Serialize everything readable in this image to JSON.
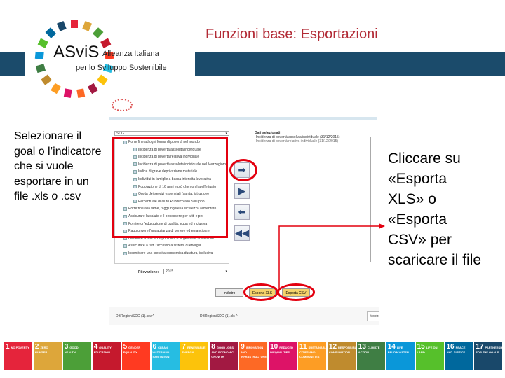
{
  "header": {
    "title": "Funzioni base: Esportazioni",
    "logo_text": "ASviS Alleanza Italiana per lo Sviluppo Sostenibile",
    "band_color": "#1b4b6b",
    "title_color": "#b22a35"
  },
  "left_text": "Selezionare il goal o l’indicatore che si vuole esportare in un file .xls o .csv",
  "right_text": "Cliccare su «Esporta XLS» o «Esporta CSV» per scaricare il file",
  "screenshot": {
    "sdg_select": "SDG",
    "tree": [
      "Porre fine ad ogni forma di povertà nel mondo",
      "Incidenza di povertà assoluta individuale",
      "Incidenza di povertà relativa individuale",
      "Incidenza di povertà assoluta individuale nel Mezzogiorno",
      "Indice di grave deprivazione materiale",
      "Individui in famiglie a bassa intensità lavorativa",
      "Popolazione di 16 anni e più che non ha effettuato",
      "Quota dei servizi essenziali (sanità, istruzione",
      "Percentuale di aiuto Pubblico allo Sviluppo",
      "Porre fine alla fame, raggiungere la sicurezza alimentare",
      "Assicurare la salute e il benessere per tutti e per",
      "Fornire un'educazione di qualità, equa ed inclusiva",
      "Raggiungere l'uguaglianza di genere ed emancipare",
      "Garantire a tutti la disponibilità e la gestione sostenibile",
      "Assicurare a tutti l'accesso a sistemi di energia",
      "Incentivare una crescita economica duratura, inclusiva"
    ],
    "selected_title": "Dati selezionati",
    "selected": [
      "Incidenza di povertà assoluta individuale (31/12/2015)",
      "Incidenza di povertà relativa individuale (31/12/2015)"
    ],
    "rilevazione_label": "Rilevazione:",
    "rilevazione_value": "2015",
    "buttons": {
      "back": "Indietro",
      "xls": "Esporta XLS",
      "csv": "Esporta CSV"
    },
    "downloads": [
      "DBRegioniSDG (1).csv",
      "DBRegioniSDG (1).xls"
    ],
    "show_all": "Mostra tutto"
  },
  "sdgs": [
    {
      "n": "1",
      "label": "NO POVERTY",
      "color": "#e5243b"
    },
    {
      "n": "2",
      "label": "ZERO HUNGER",
      "color": "#dda63a"
    },
    {
      "n": "3",
      "label": "GOOD HEALTH",
      "color": "#4c9f38"
    },
    {
      "n": "4",
      "label": "QUALITY EDUCATION",
      "color": "#c5192d"
    },
    {
      "n": "5",
      "label": "GENDER EQUALITY",
      "color": "#ff3a21"
    },
    {
      "n": "6",
      "label": "CLEAN WATER AND SANITATION",
      "color": "#26bde2"
    },
    {
      "n": "7",
      "label": "RENEWABLE ENERGY",
      "color": "#fcc30b"
    },
    {
      "n": "8",
      "label": "GOOD JOBS AND ECONOMIC GROWTH",
      "color": "#a21942"
    },
    {
      "n": "9",
      "label": "INNOVATION AND INFRASTRUCTURE",
      "color": "#fd6925"
    },
    {
      "n": "10",
      "label": "REDUCED INEQUALITIES",
      "color": "#dd1367"
    },
    {
      "n": "11",
      "label": "SUSTAINABLE CITIES AND COMMUNITIES",
      "color": "#fd9d24"
    },
    {
      "n": "12",
      "label": "RESPONSIBLE CONSUMPTION",
      "color": "#bf8b2e"
    },
    {
      "n": "13",
      "label": "CLIMATE ACTION",
      "color": "#3f7e44"
    },
    {
      "n": "14",
      "label": "LIFE BELOW WATER",
      "color": "#0a97d9"
    },
    {
      "n": "15",
      "label": "LIFE ON LAND",
      "color": "#56c02b"
    },
    {
      "n": "16",
      "label": "PEACE AND JUSTICE",
      "color": "#00689d"
    },
    {
      "n": "17",
      "label": "PARTNERSHIPS FOR THE GOALS",
      "color": "#19486a"
    }
  ]
}
